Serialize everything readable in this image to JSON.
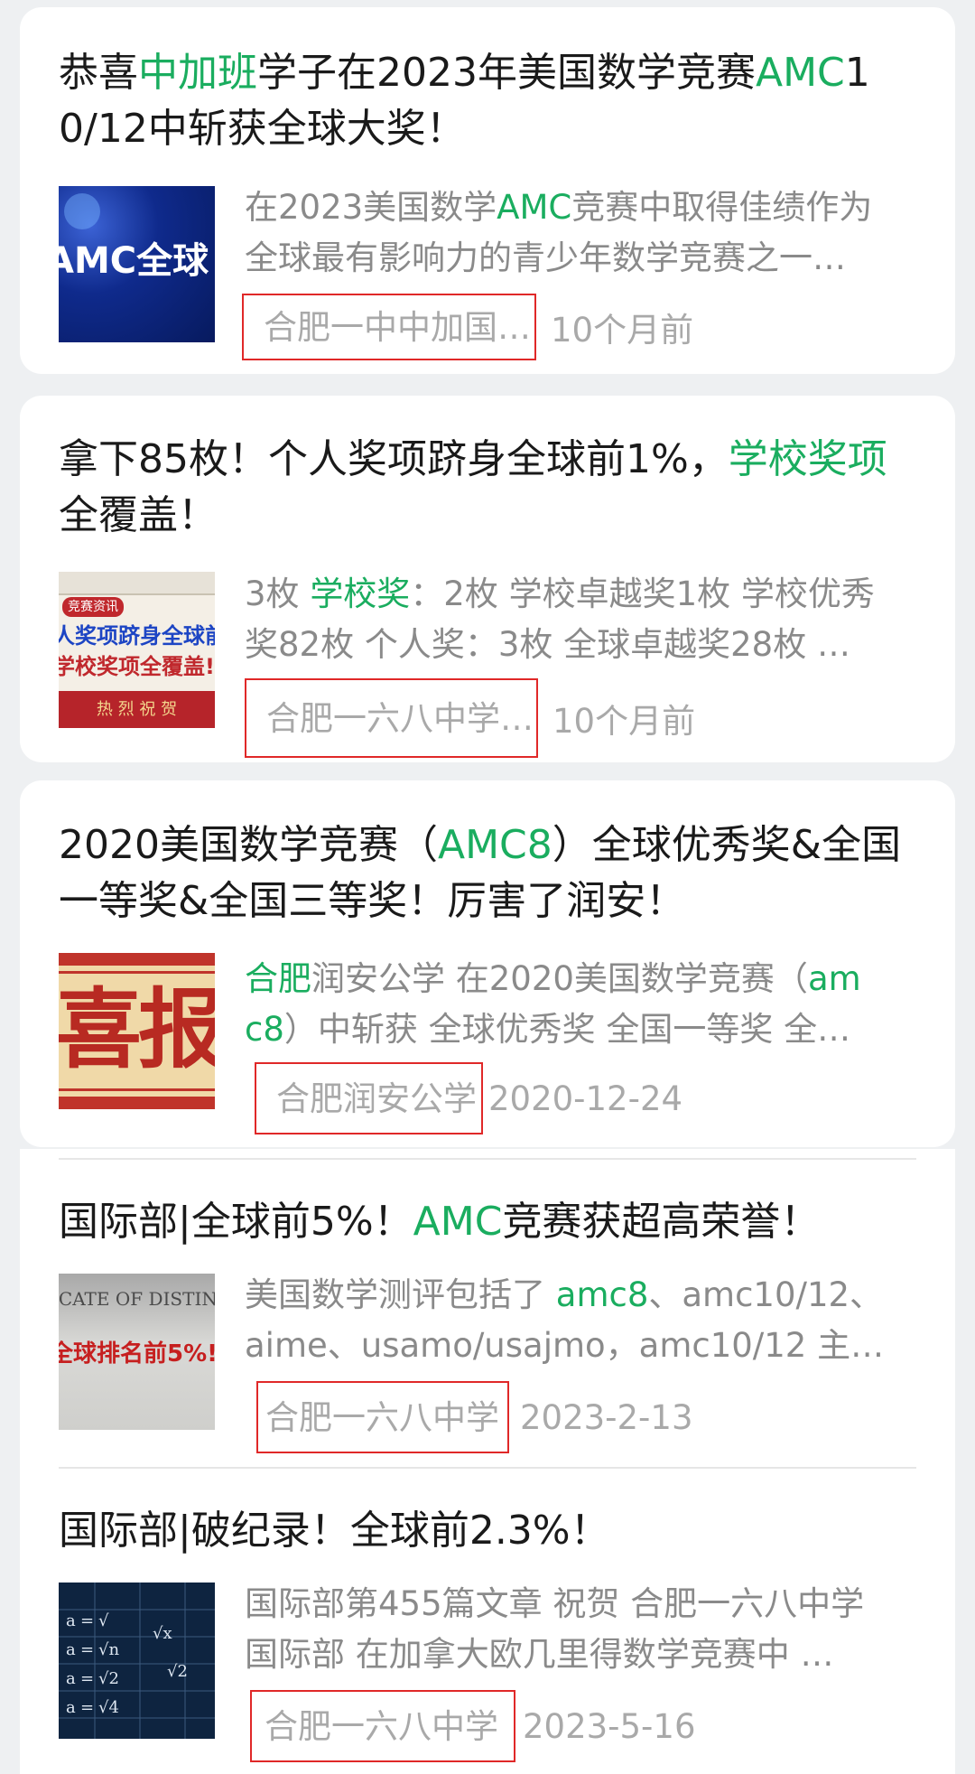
{
  "colors": {
    "accent": "#1aad5f",
    "source_box": "#e02828",
    "muted": "#a9a9a9"
  },
  "articles": [
    {
      "title_parts": [
        "恭喜",
        "中加班",
        "学子在2023年美国数学竞赛",
        "AMC",
        "1"
      ],
      "title_line2": "0/12中斩获全球大奖！",
      "thumb_text": "AMC全球",
      "snippet_parts": [
        "在2023美国数学",
        "AMC",
        "竞赛中取得佳绩作为"
      ],
      "snippet_line2": "全球最有影响力的青少年数学竞赛之一…",
      "source": "合肥一中中加国…",
      "date": "10个月前"
    },
    {
      "title_parts": [
        "拿下85枚！个人奖项跻身全球前1%，",
        "学校奖项"
      ],
      "title_line2": "全覆盖！",
      "thumb_lines": [
        "竞赛资讯",
        "人奖项跻身全球前",
        "学校奖项全覆盖!",
        "热 烈 祝 贺"
      ],
      "snippet_parts": [
        "3枚 ",
        "学校奖",
        "：2枚 学校卓越奖1枚 学校优秀"
      ],
      "snippet_line2": "奖82枚 个人奖：3枚 全球卓越奖28枚 …",
      "source": "合肥一六八中学…",
      "date": "10个月前"
    },
    {
      "title_parts": [
        "2020美国数学竞赛（",
        "AMC8",
        "）全球优秀奖&全国"
      ],
      "title_line2": "一等奖&全国三等奖！厉害了润安！",
      "thumb_text": "喜报",
      "snippet_parts": [
        "合肥",
        "润安公学 在2020美国数学竞赛（",
        "am"
      ],
      "snippet_line2_parts": [
        "c8",
        "）中斩获 全球优秀奖 全国一等奖 全…"
      ],
      "source": "合肥润安公学",
      "date": "2020-12-24"
    },
    {
      "title_parts": [
        "国际部|全球前5%！",
        "AMC",
        "竞赛获超高荣誉！"
      ],
      "thumb_lines": [
        "ICATE OF DISTINC",
        "全球排名前5%!"
      ],
      "snippet_parts": [
        "美国数学测评包括了 ",
        "amc8",
        "、amc10/12、"
      ],
      "snippet_line2": "aime、usamo/usajmo，amc10/12 主…",
      "source": "合肥一六八中学",
      "date": "2023-2-13"
    },
    {
      "title": "国际部|破纪录！全球前2.3%！",
      "snippet_line1": "国际部第455篇文章 祝贺 合肥一六八中学",
      "snippet_line2": "国际部 在加拿大欧几里得数学竞赛中 …",
      "source": "合肥一六八中学",
      "date": "2023-5-16"
    }
  ]
}
